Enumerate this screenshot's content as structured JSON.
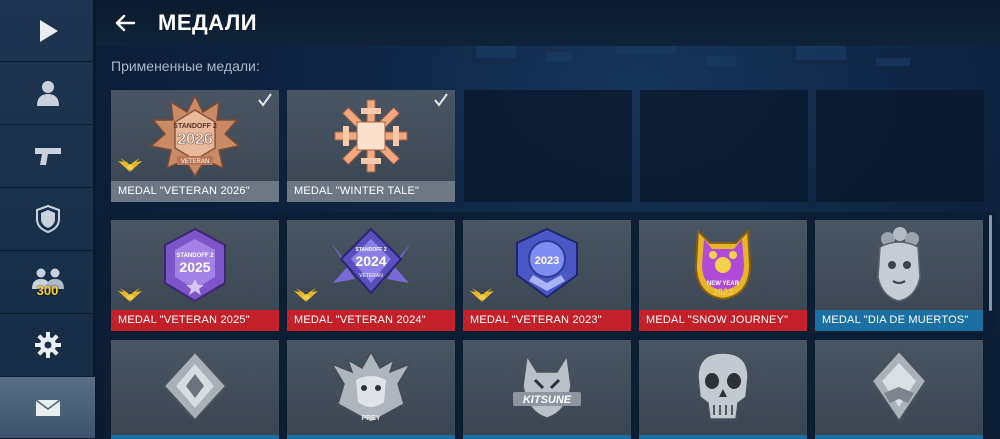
{
  "colors": {
    "sidebar": "#1d3550",
    "label_red": "#c4202a",
    "label_blue": "#1c6fa3",
    "label_gray": "#6e7884",
    "badge_gold": "#ffd23a"
  },
  "sidebar": {
    "items": [
      {
        "icon": "play-icon"
      },
      {
        "icon": "profile-icon"
      },
      {
        "icon": "pistol-icon"
      },
      {
        "icon": "shield-icon"
      },
      {
        "icon": "friends-icon",
        "badge": "300"
      },
      {
        "icon": "gear-icon"
      },
      {
        "icon": "mail-icon"
      }
    ]
  },
  "header": {
    "title": "МЕДАЛИ",
    "back_icon": "back-arrow-icon"
  },
  "applied": {
    "label": "Примененные медали:",
    "medals": [
      {
        "name": "MEDAL \"VETERAN 2026\"",
        "checked": true,
        "wings": true,
        "label_color": "gray"
      },
      {
        "name": "MEDAL \"WINTER TALE\"",
        "checked": true,
        "wings": false,
        "label_color": "gray"
      }
    ]
  },
  "inventory": {
    "row1": [
      {
        "name": "MEDAL \"VETERAN 2025\"",
        "wings": true,
        "label_color": "red"
      },
      {
        "name": "MEDAL \"VETERAN 2024\"",
        "wings": true,
        "label_color": "red"
      },
      {
        "name": "MEDAL \"VETERAN 2023\"",
        "wings": true,
        "label_color": "red"
      },
      {
        "name": "MEDAL \"SNOW JOURNEY\"",
        "wings": false,
        "label_color": "red"
      },
      {
        "name": "MEDAL \"DIA DE MUERTOS\"",
        "wings": false,
        "label_color": "blue"
      }
    ]
  },
  "medal_art": {
    "veteran_2026": {
      "top": "STANDOFF 2",
      "year": "2026",
      "ribbon": "VETERAN"
    },
    "veteran_2025": {
      "top": "STANDOFF 2",
      "year": "2025"
    },
    "veteran_2024": {
      "top": "STANDOFF 2",
      "year": "2024",
      "ribbon": "VETERAN"
    },
    "veteran_2023": {
      "year": "2023"
    },
    "snow_journey": {
      "line1": "NEW YEAR",
      "year": "2023"
    },
    "prey": "PREY",
    "kitsune": "KITSUNE"
  }
}
